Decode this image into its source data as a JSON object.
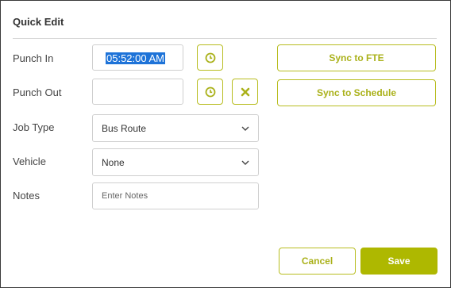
{
  "dialog": {
    "title": "Quick Edit",
    "punch_in": {
      "label": "Punch In",
      "value": "05:52:00 AM"
    },
    "punch_out": {
      "label": "Punch Out",
      "value": ""
    },
    "job_type": {
      "label": "Job Type",
      "value": "Bus Route"
    },
    "vehicle": {
      "label": "Vehicle",
      "value": "None"
    },
    "notes": {
      "label": "Notes",
      "placeholder": "Enter Notes"
    },
    "buttons": {
      "sync_fte": "Sync to FTE",
      "sync_schedule": "Sync to Schedule",
      "cancel": "Cancel",
      "save": "Save"
    }
  },
  "colors": {
    "accent": "#aeb800",
    "accent_text": "#aab11a",
    "selection": "#1e73d8"
  },
  "icons": {
    "clock": "clock-icon",
    "clear": "close-x-icon",
    "chevron": "chevron-down-icon"
  }
}
